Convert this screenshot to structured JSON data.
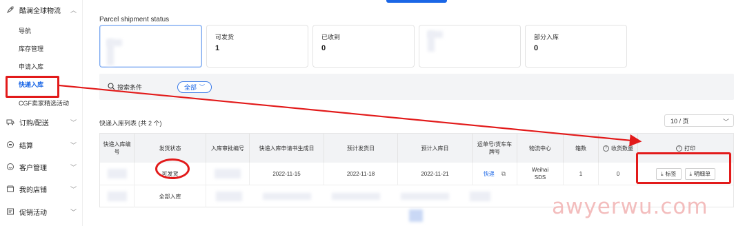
{
  "sidebar": {
    "groups": [
      {
        "label": "酷澜全球物流",
        "icon": "rocket-icon"
      },
      {
        "label": "订购/配送",
        "icon": "truck-icon"
      },
      {
        "label": "结算",
        "icon": "settlement-icon"
      },
      {
        "label": "客户管理",
        "icon": "smiley-icon"
      },
      {
        "label": "我的店铺",
        "icon": "shop-icon"
      },
      {
        "label": "促销活动",
        "icon": "promotion-icon"
      }
    ],
    "items": [
      {
        "label": "导航"
      },
      {
        "label": "库存管理"
      },
      {
        "label": "申请入库"
      },
      {
        "label": "快递入库",
        "active": true
      },
      {
        "label": "CGF卖家精选活动"
      }
    ]
  },
  "status": {
    "title": "Parcel shipment status",
    "cards": [
      {
        "label": "",
        "count": ""
      },
      {
        "label": "可发货",
        "count": "1"
      },
      {
        "label": "已收到",
        "count": "0"
      },
      {
        "label": "",
        "count": ""
      },
      {
        "label": "部分入库",
        "count": "0"
      }
    ]
  },
  "search": {
    "label": "搜索条件",
    "filter_label": "全部"
  },
  "list": {
    "title": "快递入库列表 (共 2 个)",
    "page_size": "10 / 页",
    "columns": [
      "快递入库编号",
      "发货状态",
      "入库审批编号",
      "快递入库申请书生成日",
      "预计发货日",
      "预计入库日",
      "运单号/货车车牌号",
      "物流中心",
      "箱数",
      "收货数量",
      "打印"
    ],
    "rows": [
      {
        "status": "可发货",
        "created": "2022-11-15",
        "ship_date": "2022-11-18",
        "inbound_date": "2022-11-21",
        "carrier": "快递",
        "center": "Weihai SDS",
        "boxes": "1",
        "received": "0"
      },
      {
        "status": "全部入库"
      }
    ],
    "print_buttons": {
      "label": "标签",
      "detail": "明细单"
    }
  },
  "watermark": "awyerwu.com",
  "colors": {
    "accent": "#1a66e6",
    "annotation": "#e21a1a"
  }
}
